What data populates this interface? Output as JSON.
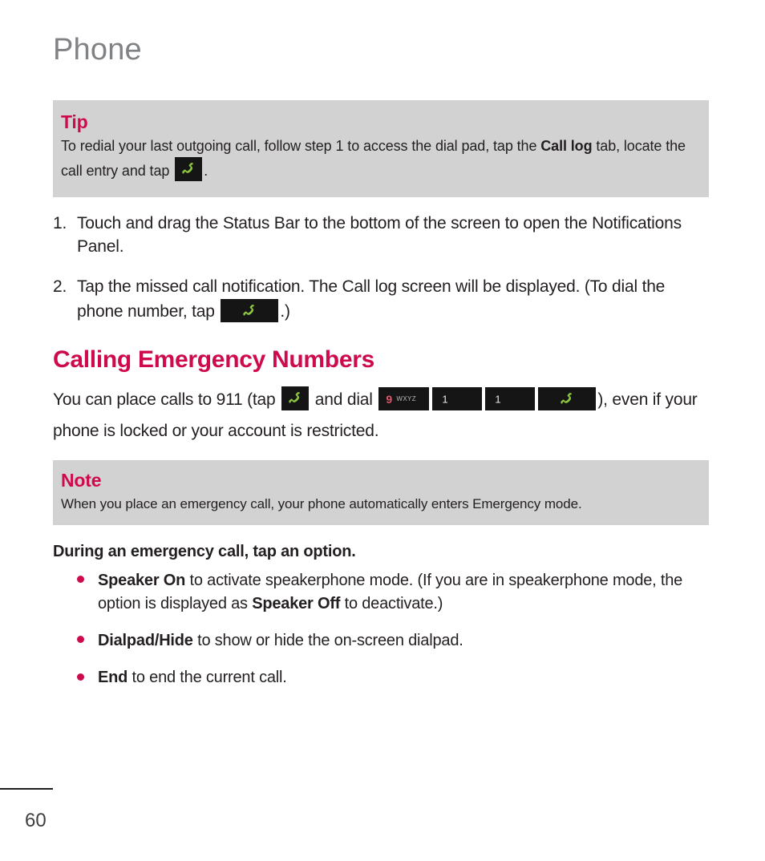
{
  "document": {
    "header_title": "Phone",
    "page_number": "60"
  },
  "tip_box": {
    "title": "Tip",
    "body_part1": "To redial your last outgoing call, follow step 1 to access the dial pad, tap the ",
    "body_bold1": "Call log",
    "body_part2": " tab, locate the call entry and tap ",
    "body_part3": "."
  },
  "steps": [
    {
      "number": "1.",
      "text": "Touch and drag the Status Bar to the bottom of the screen to open the Notifications Panel."
    },
    {
      "number": "2.",
      "text_part1": "Tap the missed call notification. The Call log screen will be displayed. (To dial the phone number, tap ",
      "text_part2": ".)"
    }
  ],
  "section": {
    "heading": "Calling Emergency Numbers",
    "paragraph_part1": "You can place calls to 911 (tap ",
    "paragraph_part2": " and dial ",
    "paragraph_part3": "), even if your phone is locked or your account is restricted."
  },
  "note_box": {
    "title": "Note",
    "body": "When you place an emergency call, your phone automatically enters Emergency mode."
  },
  "options": {
    "intro": "During an emergency call, tap an option.",
    "items": [
      {
        "bold1": "Speaker On",
        "text1": " to activate speakerphone mode. (If you are in speakerphone mode, the option is displayed as ",
        "bold2": "Speaker Off",
        "text2": " to deactivate.)"
      },
      {
        "bold1": "Dialpad/Hide",
        "text1": " to show or hide the on-screen dialpad.",
        "bold2": "",
        "text2": ""
      },
      {
        "bold1": "End",
        "text1": " to end the current call.",
        "bold2": "",
        "text2": ""
      }
    ]
  },
  "keys": {
    "phone_icon_name": "green-phone-handset",
    "digit_9": "9",
    "digit_9_letters": "WXYZ",
    "digit_1": "1"
  },
  "colors": {
    "accent": "#cf0a4c",
    "callout_bg": "#d2d2d2",
    "header_gray": "#808285",
    "key_bg": "#151515",
    "handset_green": "#8dc63f"
  }
}
